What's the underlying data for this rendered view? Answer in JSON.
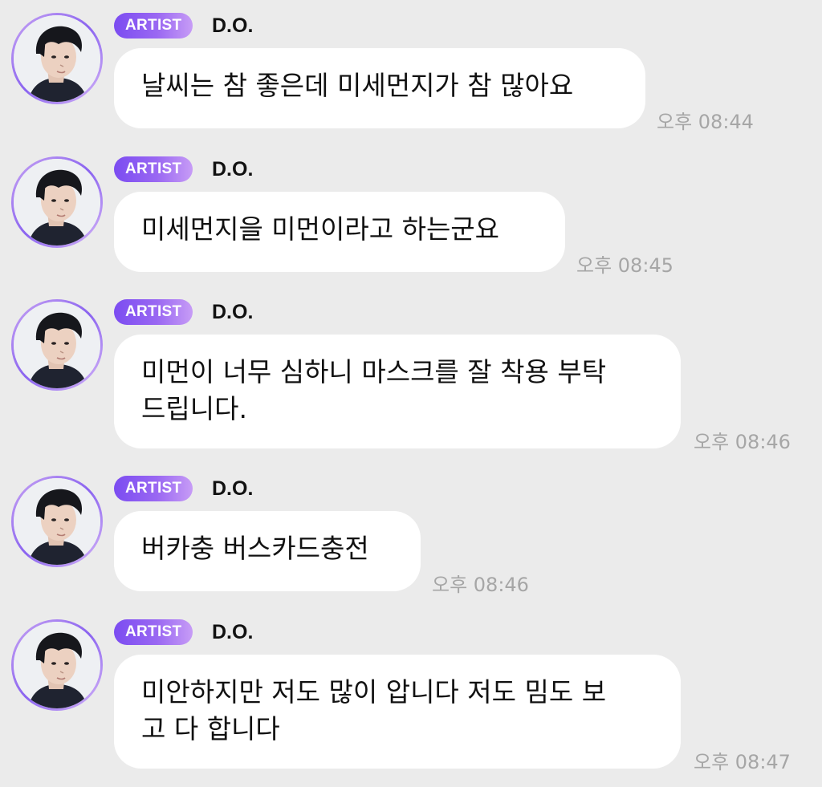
{
  "messages": [
    {
      "badge": "ARTIST",
      "sender": "D.O.",
      "text": "날씨는 참 좋은데 미세먼지가 참 많아요",
      "time": "오후 08:44"
    },
    {
      "badge": "ARTIST",
      "sender": "D.O.",
      "text": "미세먼지을 미먼이라고 하는군요",
      "time": "오후 08:45"
    },
    {
      "badge": "ARTIST",
      "sender": "D.O.",
      "text": "미먼이 너무 심하니 마스크를 잘 착용 부탁\n드립니다.",
      "time": "오후 08:46"
    },
    {
      "badge": "ARTIST",
      "sender": "D.O.",
      "text": "버카충 버스카드충전",
      "time": "오후 08:46"
    },
    {
      "badge": "ARTIST",
      "sender": "D.O.",
      "text": "미안하지만 저도 많이 압니다 저도 밈도 보\n고 다 합니다",
      "time": "오후 08:47"
    }
  ],
  "icons": {
    "avatar": "profile-photo"
  },
  "colors": {
    "background": "#ebebeb",
    "bubble": "#ffffff",
    "badge_start": "#7b4cf1",
    "badge_end": "#c79cf6",
    "timestamp": "#a6a6a6"
  }
}
